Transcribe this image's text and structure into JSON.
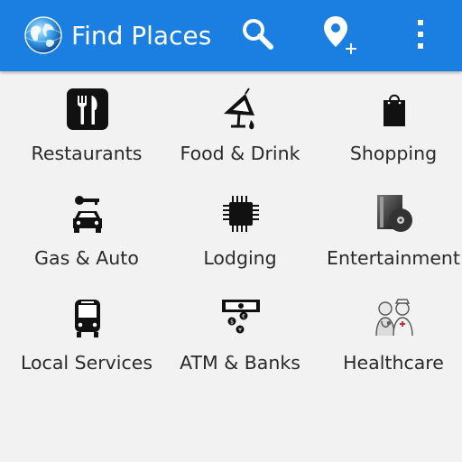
{
  "action_bar": {
    "title": "Find Places",
    "background_color": "#1a7fe0",
    "app_icon": "globe-icon",
    "actions": [
      {
        "name": "search",
        "icon": "search-icon"
      },
      {
        "name": "add-place",
        "icon": "add-location-icon"
      },
      {
        "name": "overflow-menu",
        "icon": "more-vertical-icon"
      }
    ]
  },
  "categories": [
    {
      "label": "Restaurants",
      "icon": "fork-knife-icon"
    },
    {
      "label": "Food & Drink",
      "icon": "cocktail-icon"
    },
    {
      "label": "Shopping",
      "icon": "shopping-bag-icon"
    },
    {
      "label": "Gas & Auto",
      "icon": "car-key-icon"
    },
    {
      "label": "Lodging",
      "icon": "chip-icon"
    },
    {
      "label": "Entertainment",
      "icon": "media-disc-icon"
    },
    {
      "label": "Local Services",
      "icon": "bus-icon"
    },
    {
      "label": "ATM & Banks",
      "icon": "atm-money-icon"
    },
    {
      "label": "Healthcare",
      "icon": "doctor-nurse-icon"
    }
  ]
}
